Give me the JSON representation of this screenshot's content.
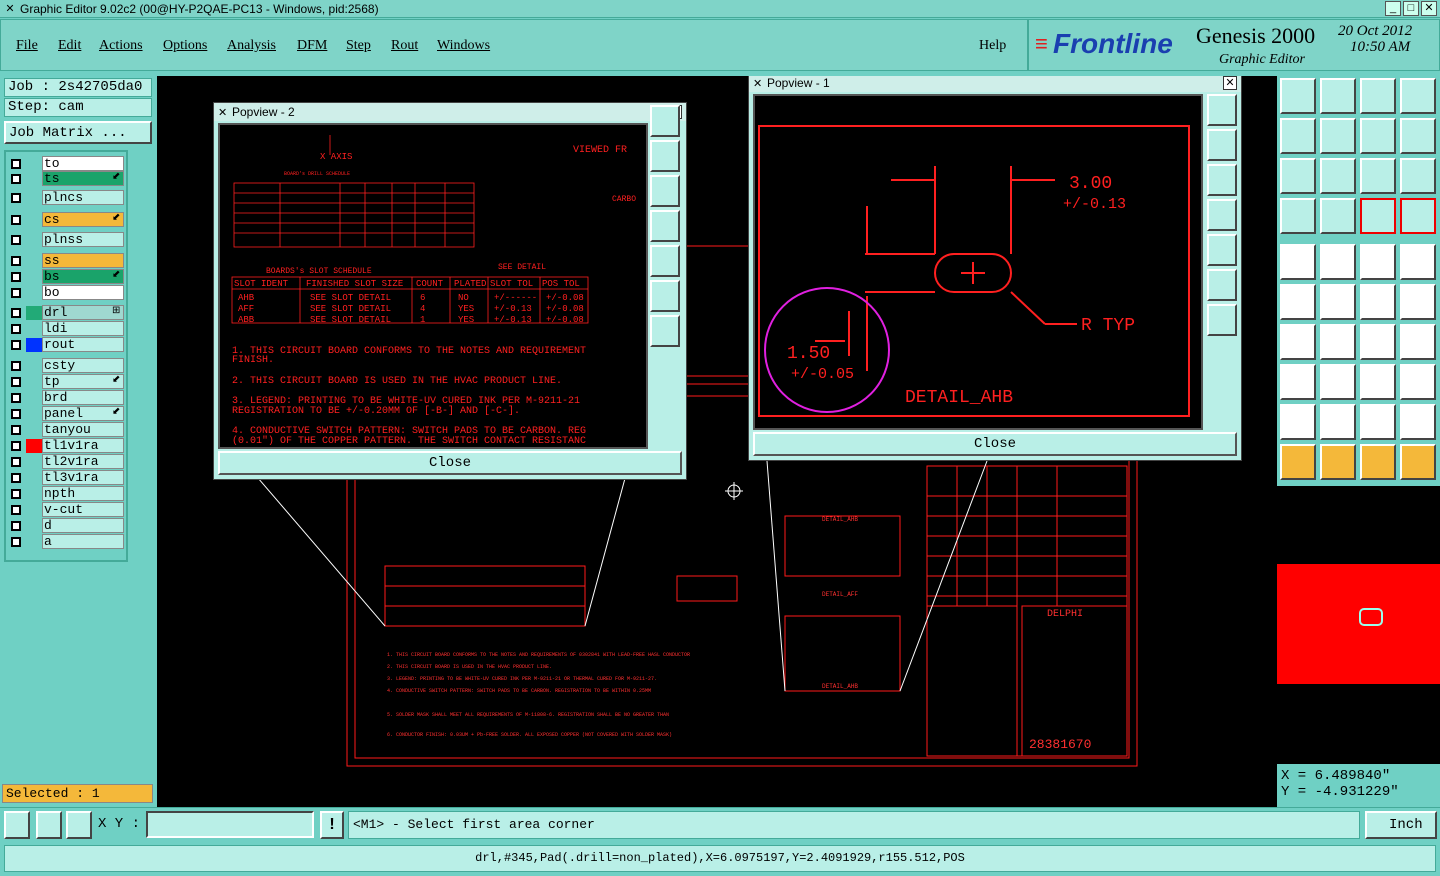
{
  "window": {
    "title": "Graphic Editor 9.02c2 (00@HY-P2QAE-PC13 - Windows, pid:2568)",
    "min": "_",
    "max": "□",
    "close": "✕"
  },
  "menu": {
    "items": [
      "File",
      "Edit",
      "Actions",
      "Options",
      "Analysis",
      "DFM",
      "Step",
      "Rout",
      "Windows"
    ],
    "help": "Help"
  },
  "brand": {
    "logo": "Frontline",
    "product": "Genesis 2000",
    "subtitle": "Graphic Editor",
    "date": "20 Oct 2012",
    "time": "10:50 AM"
  },
  "job": {
    "job_label": "Job : 2s42705da0",
    "step_label": "Step: cam",
    "matrix_button": "Job Matrix ..."
  },
  "layers": [
    {
      "name": "to",
      "bg": "#ffffff",
      "swatch": ""
    },
    {
      "name": "ts",
      "bg": "#1aa36a",
      "swatch": "",
      "mark": "⬋"
    },
    {
      "name": "plncs",
      "bg": "#b9efe7",
      "swatch": ""
    },
    {
      "name": "cs",
      "bg": "#f4b83a",
      "swatch": "",
      "mark": "⬋"
    },
    {
      "name": "plnss",
      "bg": "#b9efe7",
      "swatch": ""
    },
    {
      "name": "ss",
      "bg": "#f4b83a",
      "swatch": ""
    },
    {
      "name": "bs",
      "bg": "#1aa36a",
      "swatch": "",
      "mark": "⬋"
    },
    {
      "name": "bo",
      "bg": "#ffffff",
      "swatch": ""
    },
    {
      "name": "drl",
      "bg": "#9fd8d0",
      "swatch": "#2a7",
      "mark": "⊞"
    },
    {
      "name": "ldi",
      "bg": "#b9efe7",
      "swatch": ""
    },
    {
      "name": "rout",
      "bg": "#b9efe7",
      "swatch": "#0033ff"
    },
    {
      "name": "csty",
      "bg": "#b9efe7",
      "swatch": ""
    },
    {
      "name": "tp",
      "bg": "#b9efe7",
      "swatch": "",
      "mark": "⬋"
    },
    {
      "name": "brd",
      "bg": "#b9efe7",
      "swatch": ""
    },
    {
      "name": "panel",
      "bg": "#b9efe7",
      "swatch": "",
      "mark": "⬋"
    },
    {
      "name": "tanyou",
      "bg": "#b9efe7",
      "swatch": ""
    },
    {
      "name": "tl1v1ra",
      "bg": "#b9efe7",
      "swatch": "#ff0000"
    },
    {
      "name": "tl2v1ra",
      "bg": "#b9efe7",
      "swatch": ""
    },
    {
      "name": "tl3v1ra",
      "bg": "#b9efe7",
      "swatch": ""
    },
    {
      "name": "npth",
      "bg": "#b9efe7",
      "swatch": ""
    },
    {
      "name": "v-cut",
      "bg": "#b9efe7",
      "swatch": ""
    },
    {
      "name": "d",
      "bg": "#b9efe7",
      "swatch": ""
    },
    {
      "name": "a",
      "bg": "#b9efe7",
      "swatch": ""
    }
  ],
  "selected": "Selected : 1",
  "popview2": {
    "title": "Popview - 2",
    "close": "Close",
    "axis": "X AXIS",
    "viewed": "VIEWED FR",
    "carbo": "CARBO",
    "drill_schedule_title": "BOARD's DRILL SCHEDULE",
    "slot_schedule_title": "BOARDS's SLOT SCHEDULE",
    "see_detail": "SEE DETAIL",
    "slot_headers": [
      "SLOT IDENT",
      "FINISHED SLOT SIZE",
      "COUNT",
      "PLATED",
      "SLOT TOL",
      "POS TOL"
    ],
    "slot_rows": [
      [
        "AHB",
        "SEE SLOT DETAIL",
        "6",
        "NO",
        "+/------",
        "+/-0.08"
      ],
      [
        "AFF",
        "SEE SLOT DETAIL",
        "4",
        "YES",
        "+/-0.13",
        "+/-0.08"
      ],
      [
        "ABB",
        "SEE SLOT DETAIL",
        "1",
        "YES",
        "+/-0.13",
        "+/-0.08"
      ]
    ],
    "notes": [
      "1. THIS CIRCUIT BOARD CONFORMS TO THE NOTES AND REQUIREMENT",
      "FINISH.",
      "2. THIS CIRCUIT BOARD IS USED IN THE HVAC PRODUCT LINE.",
      "3. LEGEND: PRINTING TO BE WHITE-UV CURED INK PER M-9211-21",
      "REGISTRATION TO BE +/-0.20MM OF [-B-] AND [-C-].",
      "4. CONDUCTIVE SWITCH PATTERN: SWITCH PADS TO BE CARBON. REG",
      "(0.01\") OF THE COPPER PATTERN. THE SWITCH CONTACT RESISTANC"
    ]
  },
  "popview1": {
    "title": "Popview - 1",
    "close": "Close",
    "dim1": "3.00",
    "tol1": "+/-0.13",
    "dim2": "1.50",
    "tol2": "+/-0.05",
    "rtyp": "R TYP",
    "detail": "DETAIL_AHB"
  },
  "board": {
    "details": [
      "DETAIL_AHB",
      "DETAIL_AFF",
      "DETAIL_AHB"
    ],
    "part": "28381670",
    "logo": "DELPHI"
  },
  "coords": {
    "x": "X =  6.489840\"",
    "y": "Y = -4.931229\""
  },
  "bottom": {
    "xy_label": "X Y :",
    "xy_value": "",
    "prompt": "<M1> - Select first area corner",
    "unit": "Inch"
  },
  "status": "drl,#345,Pad(.drill=non_plated),X=6.0975197,Y=2.4091929,r155.512,POS"
}
